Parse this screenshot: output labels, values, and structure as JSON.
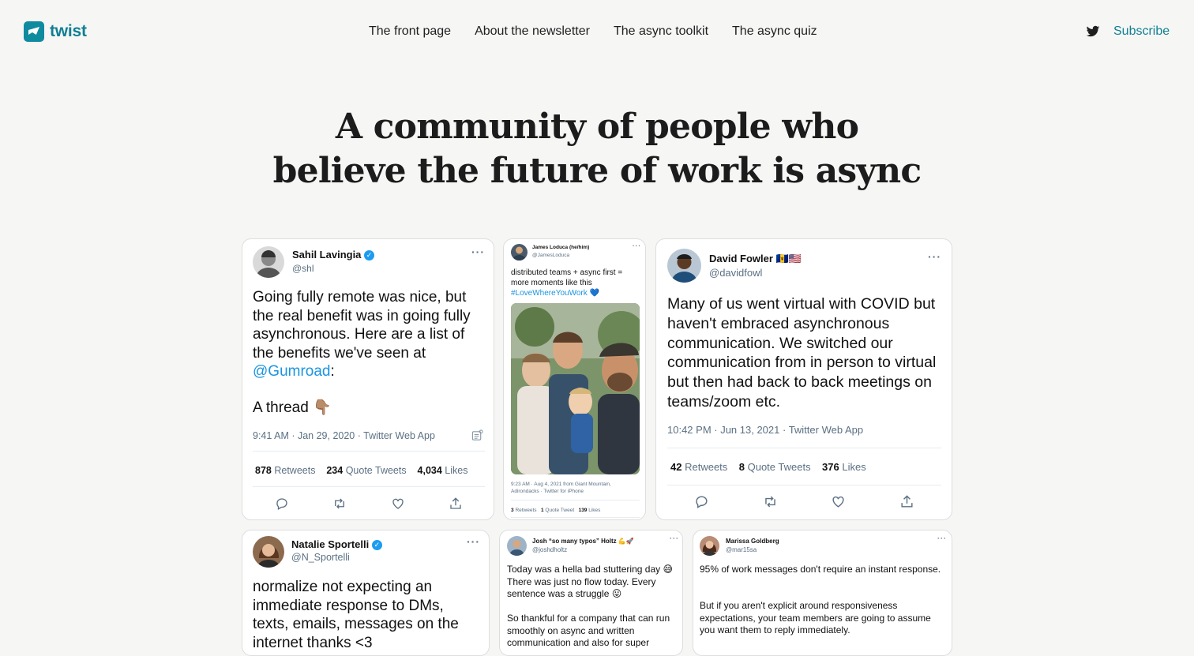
{
  "header": {
    "logo_text": "twist",
    "nav": [
      "The front page",
      "About the newsletter",
      "The async toolkit",
      "The async quiz"
    ],
    "subscribe_label": "Subscribe",
    "brand_color": "#0f8ba0"
  },
  "hero": {
    "line1": "A community of people who",
    "line2": "believe the future of work is async"
  },
  "tweets": [
    {
      "name": "Sahil Lavingia",
      "handle": "@shl",
      "text_parts": [
        "Going fully remote was nice, but the real benefit was in going fully asynchronous. Here are a list of the benefits we've seen at ",
        "@Gumroad",
        ":"
      ],
      "text_extra": "A thread 👇🏽",
      "meta": "9:41 AM · Jan 29, 2020 · Twitter Web App",
      "retweets": "878",
      "retweets_label": "Retweets",
      "quotes": "234",
      "quotes_label": "Quote Tweets",
      "likes": "4,034",
      "likes_label": "Likes"
    },
    {
      "name": "James Loduca (he/him)",
      "handle": "@JamesLoduca",
      "text": "distributed teams + async first = more moments like this",
      "hashtag": "#LoveWhereYouWork 💙",
      "meta_line1": "9:23 AM · Aug 4, 2021 from Giant Mountain,",
      "meta_line2": "Adirondacks · Twitter for iPhone",
      "retweets": "3",
      "retweets_label": "Retweets",
      "quotes": "1",
      "quotes_label": "Quote Tweet",
      "likes": "139",
      "likes_label": "Likes"
    },
    {
      "name": "David Fowler 🇧🇧🇺🇸",
      "handle": "@davidfowl",
      "text": "Many of us went virtual with COVID but haven't embraced asynchronous communication. We switched our communication from in person to virtual but then had back to back meetings on teams/zoom etc.",
      "meta": "10:42 PM · Jun 13, 2021 · Twitter Web App",
      "retweets": "42",
      "retweets_label": "Retweets",
      "quotes": "8",
      "quotes_label": "Quote Tweets",
      "likes": "376",
      "likes_label": "Likes"
    },
    {
      "name": "Natalie Sportelli",
      "handle": "@N_Sportelli",
      "text": "normalize not expecting an immediate response to DMs, texts, emails, messages on the internet thanks <3"
    },
    {
      "name": "Josh “so many typos” Holtz 💪🚀",
      "handle": "@joshdholtz",
      "text1": "Today was a hella bad stuttering day 😅 There was just no flow today. Every sentence was a struggle 😛",
      "text2": "So thankful for a company that can run smoothly on async and written communication and also for super"
    },
    {
      "name": "Marissa Goldberg",
      "handle": "@mar15sa",
      "text1": "95% of work messages don't require an instant response.",
      "text2": "But if you aren't explicit around responsiveness expectations, your team members are going to assume you want them to reply immediately."
    }
  ]
}
